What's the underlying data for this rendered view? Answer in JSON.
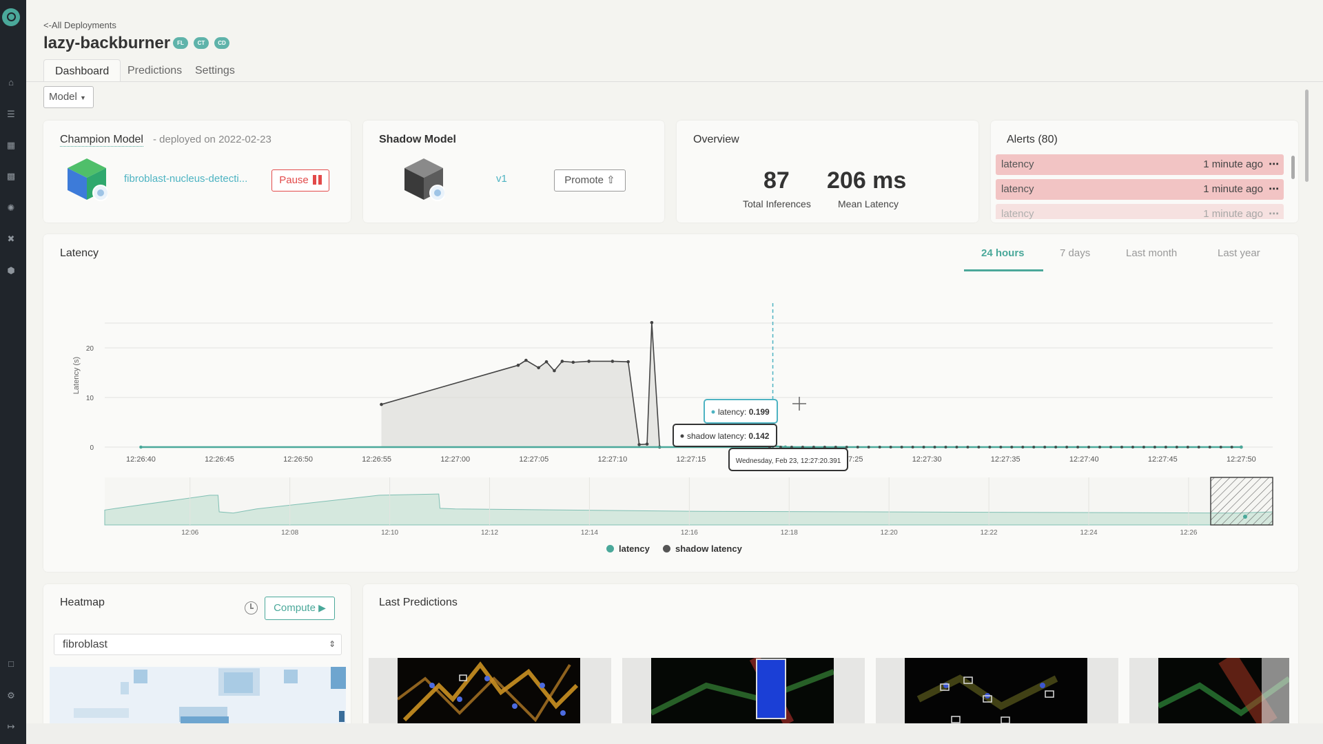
{
  "header": {
    "back_link": "<-All Deployments",
    "title": "lazy-backburner",
    "badges": [
      "FL",
      "CT",
      "CD"
    ]
  },
  "tabs": [
    "Dashboard",
    "Predictions",
    "Settings"
  ],
  "model_dropdown": "Model",
  "champion": {
    "title": "Champion Model",
    "deployed": "- deployed on 2022-02-23",
    "model_link": "fibroblast-nucleus-detecti...",
    "pause_label": "Pause"
  },
  "shadow": {
    "title": "Shadow Model",
    "version": "v1",
    "promote_label": "Promote"
  },
  "overview": {
    "title": "Overview",
    "total_inferences": "87",
    "total_inferences_label": "Total Inferences",
    "mean_latency": "206 ms",
    "mean_latency_label": "Mean Latency"
  },
  "alerts": {
    "title": "Alerts (80)",
    "items": [
      {
        "name": "latency",
        "time": "1 minute ago"
      },
      {
        "name": "latency",
        "time": "1 minute ago"
      },
      {
        "name": "latency",
        "time": "1 minute ago"
      }
    ]
  },
  "latency_card": {
    "title": "Latency",
    "ranges": [
      "24 hours",
      "7 days",
      "Last month",
      "Last year"
    ],
    "active_range": "24 hours"
  },
  "chart_data": {
    "type": "line",
    "title": "",
    "ylabel": "Latency (s)",
    "ylim": [
      0,
      25
    ],
    "yticks": [
      0,
      10,
      20
    ],
    "xticks": [
      "12:26:40",
      "12:26:45",
      "12:26:50",
      "12:26:55",
      "12:27:00",
      "12:27:05",
      "12:27:10",
      "12:27:15",
      "12:27:20",
      "12:27:25",
      "12:27:30",
      "12:27:35",
      "12:27:40",
      "12:27:45",
      "12:27:50"
    ],
    "series": [
      {
        "name": "shadow latency",
        "color": "#444444",
        "points": [
          {
            "t": 55.3,
            "v": 8.6
          },
          {
            "t": 64.0,
            "v": 16.5
          },
          {
            "t": 64.5,
            "v": 17.5
          },
          {
            "t": 65.3,
            "v": 16.0
          },
          {
            "t": 65.8,
            "v": 17.2
          },
          {
            "t": 66.3,
            "v": 15.4
          },
          {
            "t": 66.8,
            "v": 17.3
          },
          {
            "t": 67.5,
            "v": 17.1
          },
          {
            "t": 68.5,
            "v": 17.3
          },
          {
            "t": 70.0,
            "v": 17.3
          },
          {
            "t": 71.0,
            "v": 17.2
          },
          {
            "t": 71.7,
            "v": 0.5
          },
          {
            "t": 72.2,
            "v": 0.6
          },
          {
            "t": 72.5,
            "v": 25.1
          },
          {
            "t": 73.0,
            "v": 0.0
          },
          {
            "t": 80.0,
            "v": 0.0
          },
          {
            "t": 80.2,
            "v": 0.142
          },
          {
            "t": 81.0,
            "v": 0.0
          },
          {
            "t": 110.0,
            "v": 0.0
          }
        ]
      },
      {
        "name": "latency",
        "color": "#4aa89a",
        "points": [
          {
            "t": 40.0,
            "v": 0.0
          },
          {
            "t": 80.0,
            "v": 0.0
          },
          {
            "t": 80.2,
            "v": 0.199
          },
          {
            "t": 81.0,
            "v": 0.0
          },
          {
            "t": 110.0,
            "v": 0.0
          }
        ]
      }
    ],
    "tooltip": {
      "latency": "0.199",
      "latency_label": "latency:",
      "shadow_latency": "0.142",
      "shadow_latency_label": "shadow latency:",
      "timestamp": "Wednesday, Feb 23, 12:27:20.391"
    },
    "navigator": {
      "xticks": [
        "12:06",
        "12:08",
        "12:10",
        "12:12",
        "12:14",
        "12:16",
        "12:18",
        "12:20",
        "12:22",
        "12:24",
        "12:26"
      ]
    },
    "legend": [
      "latency",
      "shadow latency"
    ]
  },
  "heatmap": {
    "title": "Heatmap",
    "compute_label": "Compute",
    "select_value": "fibroblast"
  },
  "last_predictions": {
    "title": "Last Predictions"
  },
  "colors": {
    "accent": "#4aa89a",
    "link": "#4db3c2",
    "alert": "#f2c4c4",
    "danger": "#e24a4a"
  }
}
